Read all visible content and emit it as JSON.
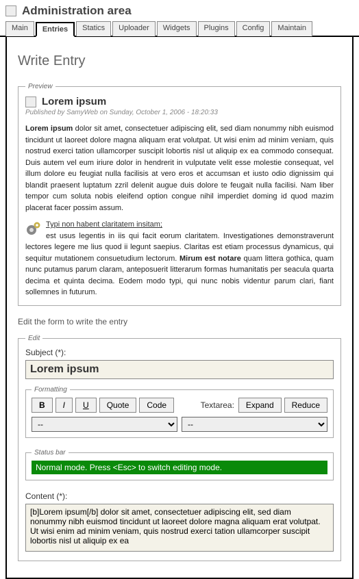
{
  "header": {
    "title": "Administration area"
  },
  "tabs": [
    {
      "label": "Main",
      "active": false
    },
    {
      "label": "Entries",
      "active": true
    },
    {
      "label": "Statics",
      "active": false
    },
    {
      "label": "Uploader",
      "active": false
    },
    {
      "label": "Widgets",
      "active": false
    },
    {
      "label": "Plugins",
      "active": false
    },
    {
      "label": "Config",
      "active": false
    },
    {
      "label": "Maintain",
      "active": false
    }
  ],
  "page": {
    "title": "Write Entry"
  },
  "preview": {
    "legend": "Preview",
    "title": "Lorem ipsum",
    "meta": "Published by SamyWeb on Sunday, October 1, 2006 - 18:20:33",
    "p1_lead": "Lorem ipsum",
    "p1": " dolor sit amet, consectetuer adipiscing elit, sed diam nonummy nibh euismod tincidunt ut laoreet dolore magna aliquam erat volutpat. Ut wisi enim ad minim veniam, quis nostrud exerci tation ullamcorper suscipit lobortis nisl ut aliquip ex ea commodo consequat. Duis autem vel eum iriure dolor in hendrerit in vulputate velit esse molestie consequat, vel illum dolore eu feugiat nulla facilisis at vero eros et accumsan et iusto odio dignissim qui blandit praesent luptatum zzril delenit augue duis dolore te feugait nulla facilisi. Nam liber tempor cum soluta nobis eleifend option congue nihil imperdiet doming id quod mazim placerat facer possim assum.",
    "p2_link": "Typi non habent claritatem insitam;",
    "p2_a": " est usus legentis in iis qui facit eorum claritatem. Investigationes demonstraverunt lectores legere me lius quod ii legunt saepius. Claritas est etiam processus dynamicus, qui sequitur mutationem consuetudium lectorum. ",
    "p2_bold": "Mirum est notare",
    "p2_b": " quam littera gothica, quam nunc putamus parum claram, anteposuerit litterarum formas humanitatis per seacula quarta decima et quinta decima. Eodem modo typi, qui nunc nobis videntur parum clari, fiant sollemnes in futurum."
  },
  "edit": {
    "instruction": "Edit the form to write the entry",
    "legend": "Edit",
    "subject_label": "Subject (*):",
    "subject_value": "Lorem ipsum",
    "formatting": {
      "legend": "Formatting",
      "bold": "B",
      "italic": "I",
      "underline": "U",
      "quote": "Quote",
      "code": "Code",
      "textarea_label": "Textarea:",
      "expand": "Expand",
      "reduce": "Reduce",
      "select1": "--",
      "select2": "--"
    },
    "status": {
      "legend": "Status bar",
      "text": "Normal mode. Press <Esc> to switch editing mode."
    },
    "content_label": "Content (*):",
    "content_value": "[b]Lorem ipsum[/b] dolor sit amet, consectetuer adipiscing elit, sed diam nonummy nibh euismod tincidunt ut laoreet dolore magna aliquam erat volutpat. Ut wisi enim ad minim veniam, quis nostrud exerci tation ullamcorper suscipit lobortis nisl ut aliquip ex ea"
  }
}
